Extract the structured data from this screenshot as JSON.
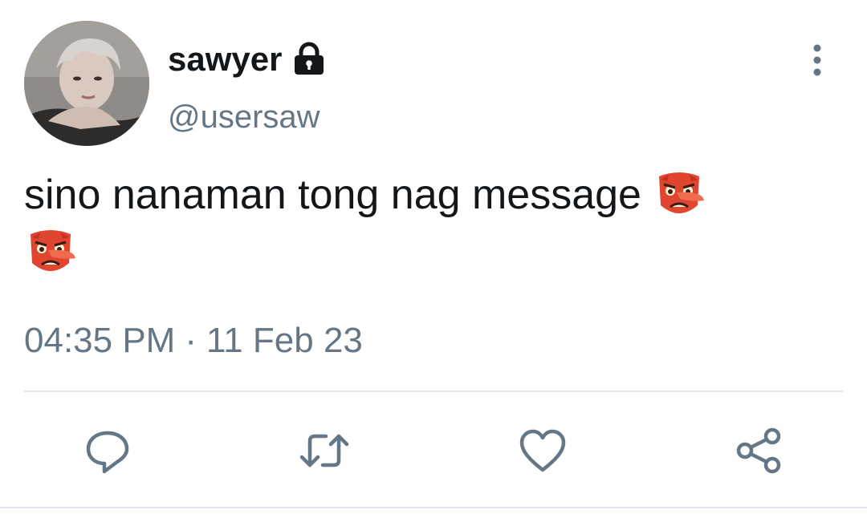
{
  "user": {
    "display_name": "sawyer",
    "handle": "@usersaw",
    "avatar_icon": "profile-photo",
    "protected_icon": "lock-icon"
  },
  "tweet": {
    "text": "sino nanaman tong nag message",
    "emoji": [
      "👺",
      "👺"
    ],
    "time": "04:35 PM",
    "separator": "·",
    "date": "11 Feb 23"
  },
  "actions": {
    "icons": [
      "reply-icon",
      "retweet-icon",
      "like-icon",
      "share-icon"
    ]
  },
  "colors": {
    "primary_text": "#14171a",
    "secondary_text": "#657786",
    "icon_gray": "#657786",
    "divider": "#e1e8ed",
    "background": "#ffffff"
  }
}
